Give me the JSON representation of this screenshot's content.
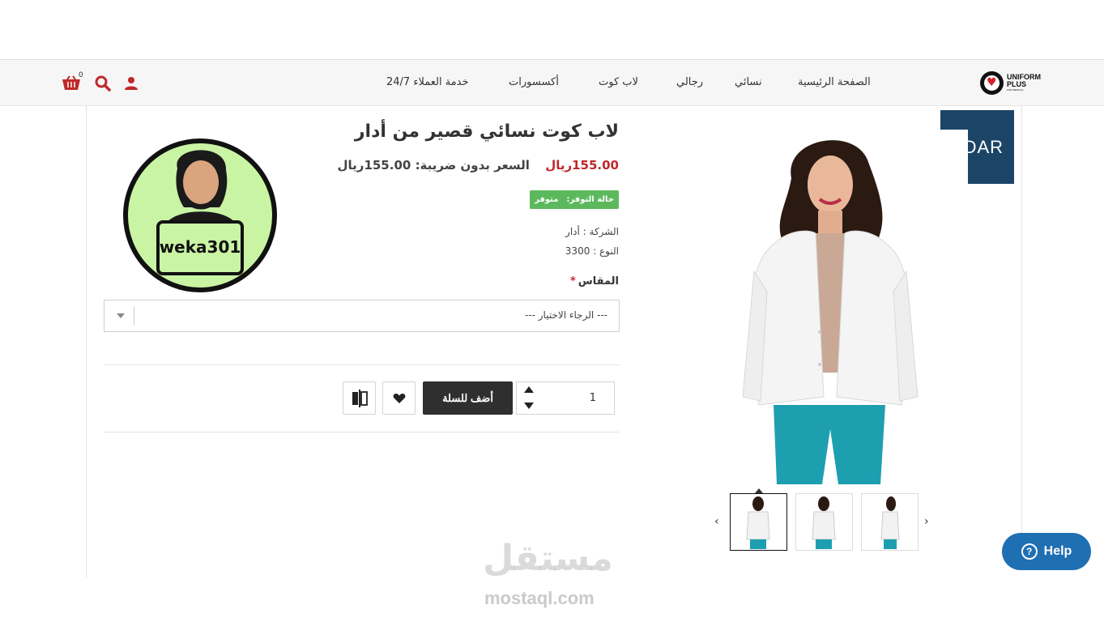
{
  "header": {
    "logo_line1": "UNIFORM",
    "logo_line2": "PLUS",
    "logo_line3": "FOR MEDICAL",
    "nav": [
      "الصفحة الرئيسية",
      "نسائي",
      "رجالي",
      "لاب كوت",
      "أكسسورات",
      "خدمة العملاء 24/7"
    ],
    "cart_count": "0",
    "icons": [
      "user-icon",
      "search-icon",
      "cart-icon"
    ]
  },
  "gallery": {
    "brand": "ADAR",
    "thumbnails_count": 3,
    "active_thumbnail": 1
  },
  "avatar": {
    "label": "weka301"
  },
  "product": {
    "title": "لاب كوت نسائي قصير من أدار",
    "price": "155.00ريال",
    "price_ex_tax_label": "السعر بدون ضريبة:",
    "price_ex_tax": "155.00ريال",
    "stock_label": "حالة التوفر:",
    "stock_value": "متوفر",
    "company": "الشركة : أدار",
    "model": "النوع : 3300",
    "size_label": "المقاس",
    "size_placeholder": "--- الرجاء الاختيار ---",
    "quantity": "1",
    "add_to_cart": "أضف للسلة"
  },
  "help": {
    "label": "Help"
  },
  "watermark": {
    "arabic": "مستقل",
    "english": "mostaql.com"
  },
  "colors": {
    "price": "#c0292b",
    "stock_badge": "#5cb85c",
    "brand_badge": "#1c4467",
    "help_button": "#1f6fb3",
    "icon_red": "#c0292b",
    "avatar_bg": "#c9f4a4"
  }
}
